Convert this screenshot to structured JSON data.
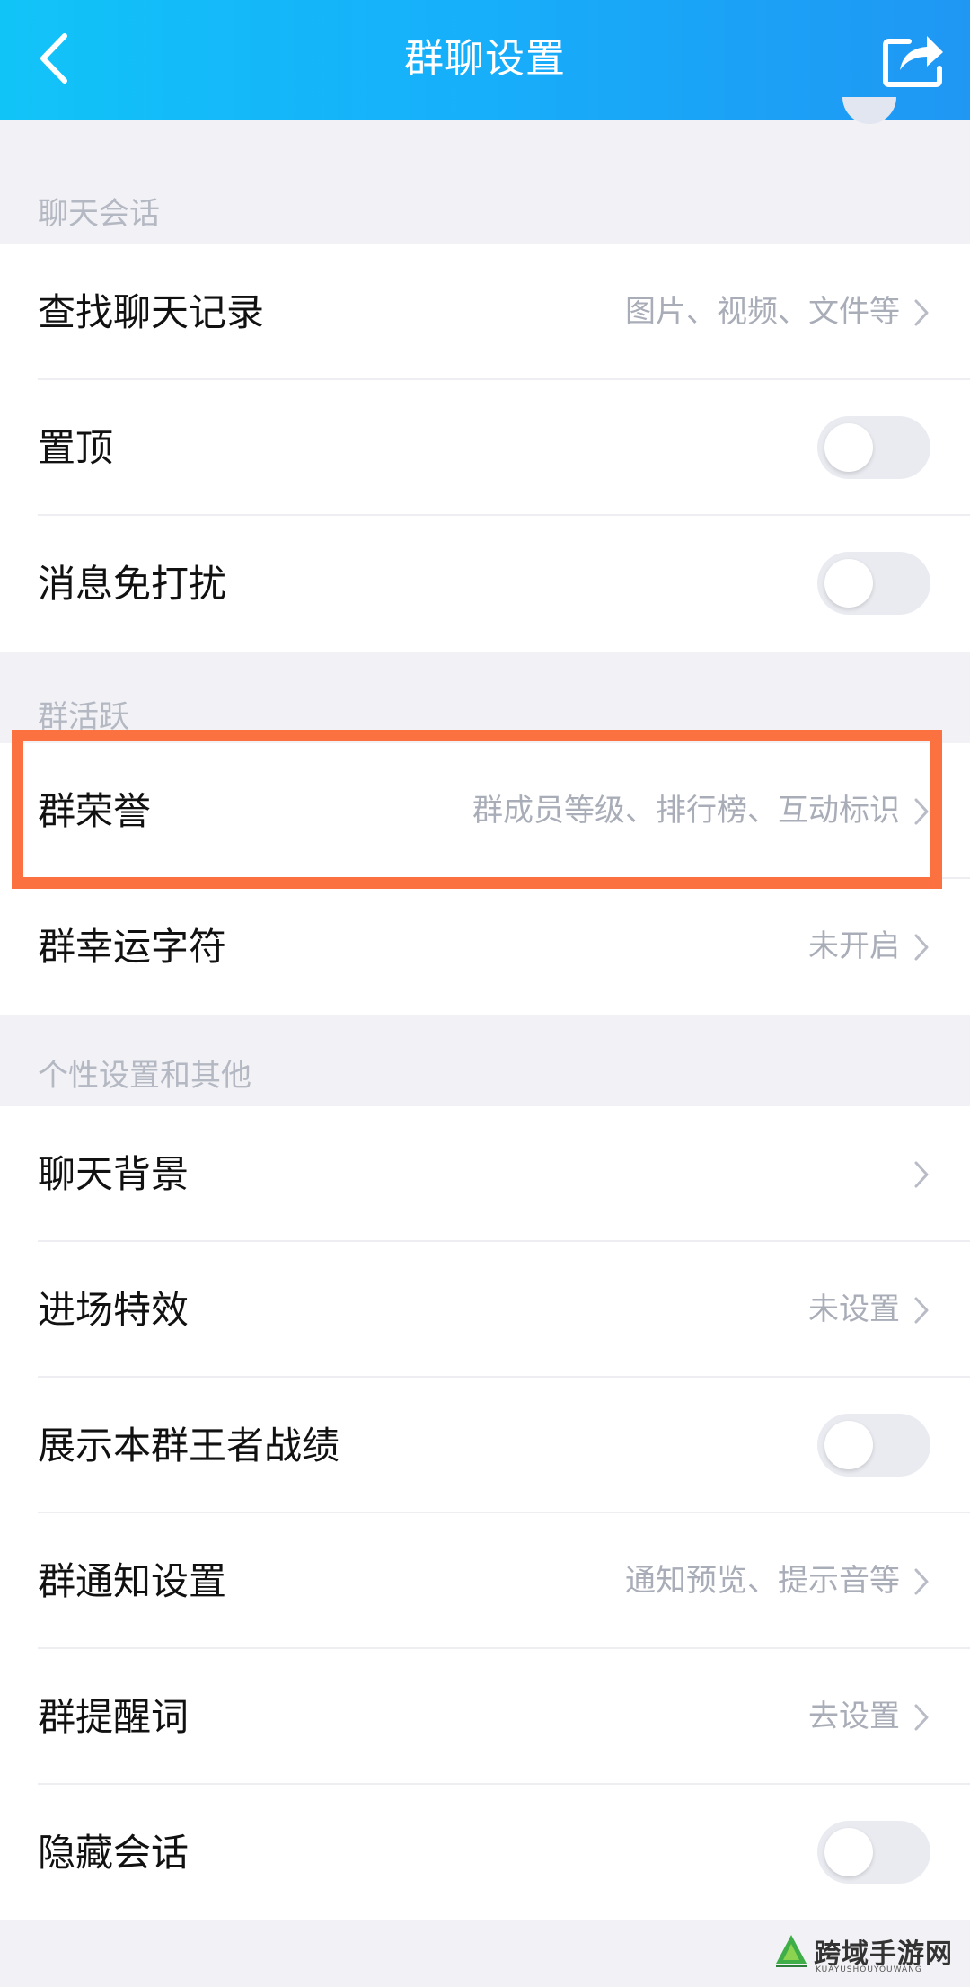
{
  "header": {
    "title": "群聊设置",
    "back_icon": "chevron-left-icon",
    "share_icon": "share-icon"
  },
  "sections": {
    "chat": {
      "title": "聊天会话",
      "items": [
        {
          "label": "查找聊天记录",
          "value": "图片、视频、文件等",
          "type": "link"
        },
        {
          "label": "置顶",
          "type": "toggle",
          "on": false
        },
        {
          "label": "消息免打扰",
          "type": "toggle",
          "on": false
        }
      ]
    },
    "activity": {
      "title": "群活跃",
      "items": [
        {
          "label": "群荣誉",
          "value": "群成员等级、排行榜、互动标识",
          "type": "link"
        },
        {
          "label": "群幸运字符",
          "value": "未开启",
          "type": "link"
        }
      ]
    },
    "personal": {
      "title": "个性设置和其他",
      "items": [
        {
          "label": "聊天背景",
          "value": "",
          "type": "link"
        },
        {
          "label": "进场特效",
          "value": "未设置",
          "type": "link"
        },
        {
          "label": "展示本群王者战绩",
          "type": "toggle",
          "on": false
        },
        {
          "label": "群通知设置",
          "value": "通知预览、提示音等",
          "type": "link"
        },
        {
          "label": "群提醒词",
          "value": "去设置",
          "type": "link"
        },
        {
          "label": "隐藏会话",
          "type": "toggle",
          "on": false
        }
      ]
    }
  },
  "highlight": {
    "target": "群荣誉",
    "color": "#fb7240"
  },
  "watermark": {
    "text": "跨域手游网",
    "subtext": "KUAYUSHOUYOUWANG"
  },
  "colors": {
    "header_start": "#11c4f8",
    "header_end": "#1f97f3",
    "background": "#f2f2f6",
    "secondary_text": "#a9adb8",
    "section_title": "#b4b8c2",
    "toggle_off": "#e9ebf1"
  }
}
